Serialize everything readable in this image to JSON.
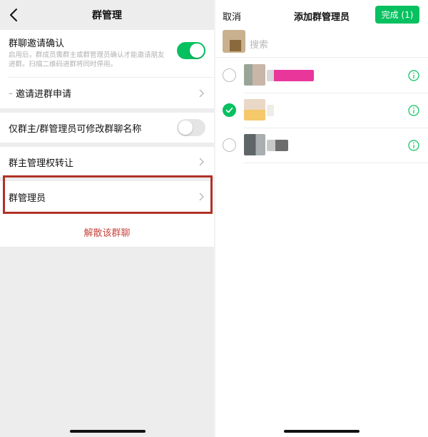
{
  "left": {
    "nav_title": "群管理",
    "invite_confirm": {
      "label": "群聊邀请确认",
      "description": "启用后，群成员需群主或群管理员确认才能邀请朋友进群。扫描二维码进群将同时停用。",
      "enabled": true
    },
    "invite_requests": {
      "label": "邀请进群申请"
    },
    "owner_admin_only_rename": {
      "label": "仅群主/群管理员可修改群聊名称",
      "enabled": false
    },
    "transfer_owner": {
      "label": "群主管理权转让"
    },
    "group_admins": {
      "label": "群管理员"
    },
    "dissolve": {
      "label": "解散该群聊"
    },
    "colors": {
      "accent": "#07c160",
      "danger": "#c8473f",
      "highlight": "#b03127"
    }
  },
  "right": {
    "cancel": "取消",
    "title": "添加群管理员",
    "done": "完成 (1)",
    "search_placeholder": "搜索",
    "contacts": [
      {
        "checked": false,
        "info_icon": "info-icon"
      },
      {
        "checked": true,
        "info_icon": "info-icon"
      },
      {
        "checked": false,
        "info_icon": "info-icon"
      }
    ]
  }
}
